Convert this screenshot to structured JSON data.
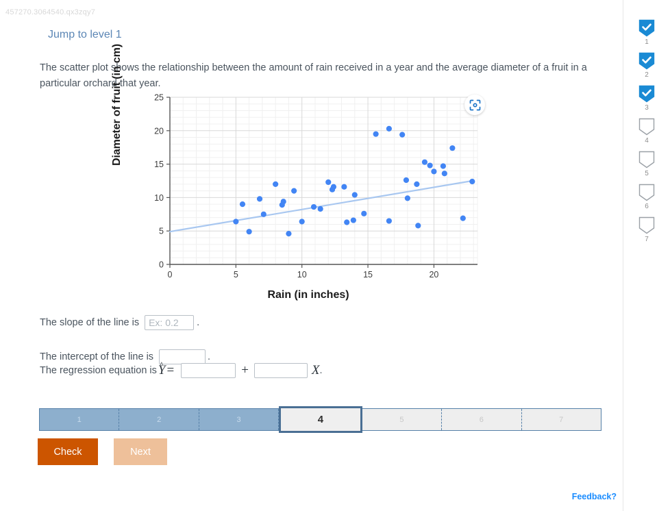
{
  "question_id": "457270.3064540.qx3zqy7",
  "jump_link": "Jump to level 1",
  "prompt": "The scatter plot shows the relationship between the amount of rain received in a year and the average diameter of a fruit in a particular orchard that year.",
  "chart_icon": "focus-scan-icon",
  "questions": {
    "slope_prefix": "The slope of the line is",
    "slope_placeholder": "Ex: 0.2",
    "slope_value": "",
    "slope_suffix": ".",
    "intercept_prefix": "The intercept of the line is",
    "intercept_placeholder": "",
    "intercept_value": "",
    "intercept_suffix": ".",
    "equation_prefix": "The regression equation is",
    "equation_yhat": "Y",
    "equation_hat": "^",
    "equation_equals": "=",
    "equation_plus": "+",
    "equation_x": "X",
    "equation_suffix": ".",
    "eq_a_value": "",
    "eq_b_value": ""
  },
  "progress": {
    "segments": [
      {
        "label": "1",
        "state": "done"
      },
      {
        "label": "2",
        "state": "done"
      },
      {
        "label": "3",
        "state": "done"
      },
      {
        "label": "4",
        "state": "current"
      },
      {
        "label": "5",
        "state": "todo"
      },
      {
        "label": "6",
        "state": "todo"
      },
      {
        "label": "7",
        "state": "todo"
      }
    ]
  },
  "buttons": {
    "check": "Check",
    "next": "Next"
  },
  "rail": {
    "items": [
      {
        "label": "1",
        "checked": true
      },
      {
        "label": "2",
        "checked": true
      },
      {
        "label": "3",
        "checked": true
      },
      {
        "label": "4",
        "checked": false
      },
      {
        "label": "5",
        "checked": false
      },
      {
        "label": "6",
        "checked": false
      },
      {
        "label": "7",
        "checked": false
      }
    ]
  },
  "feedback": "Feedback?",
  "colors": {
    "point": "#4285f4",
    "trendline": "#a8c7f0",
    "accent_orange": "#cc5500",
    "accent_blue": "#1a8cff",
    "progress_done": "#8dafcd"
  },
  "chart_data": {
    "type": "scatter",
    "title": "",
    "xlabel": "Rain (in inches)",
    "ylabel": "Diameter of fruit (in cm)",
    "xlim": [
      0,
      23.3
    ],
    "ylim": [
      0,
      25
    ],
    "xticks": [
      0,
      5,
      10,
      15,
      20
    ],
    "yticks": [
      0,
      5,
      10,
      15,
      20,
      25
    ],
    "grid": true,
    "minor_grid_step_x": 1,
    "minor_grid_step_y": 1,
    "legend": "none",
    "points": [
      [
        5.0,
        6.4
      ],
      [
        5.5,
        9.0
      ],
      [
        6.0,
        4.9
      ],
      [
        6.8,
        9.8
      ],
      [
        7.1,
        7.5
      ],
      [
        8.0,
        12.0
      ],
      [
        8.5,
        8.9
      ],
      [
        8.6,
        9.4
      ],
      [
        9.0,
        4.6
      ],
      [
        9.4,
        11.0
      ],
      [
        10.0,
        6.4
      ],
      [
        10.9,
        8.6
      ],
      [
        11.4,
        8.3
      ],
      [
        12.0,
        12.3
      ],
      [
        12.3,
        11.2
      ],
      [
        12.4,
        11.6
      ],
      [
        13.2,
        11.6
      ],
      [
        13.4,
        6.3
      ],
      [
        13.9,
        6.6
      ],
      [
        14.0,
        10.4
      ],
      [
        14.7,
        7.6
      ],
      [
        15.6,
        19.5
      ],
      [
        16.6,
        20.3
      ],
      [
        16.6,
        6.5
      ],
      [
        17.6,
        19.4
      ],
      [
        17.9,
        12.6
      ],
      [
        18.0,
        9.9
      ],
      [
        18.7,
        12.0
      ],
      [
        18.8,
        5.8
      ],
      [
        19.3,
        15.3
      ],
      [
        19.7,
        14.8
      ],
      [
        20.0,
        13.9
      ],
      [
        20.7,
        14.7
      ],
      [
        20.8,
        13.6
      ],
      [
        21.4,
        17.4
      ],
      [
        22.2,
        6.9
      ],
      [
        22.9,
        12.4
      ]
    ],
    "trendline": {
      "x0": 0,
      "y0": 4.9,
      "x1": 22.9,
      "y1": 12.5
    }
  }
}
